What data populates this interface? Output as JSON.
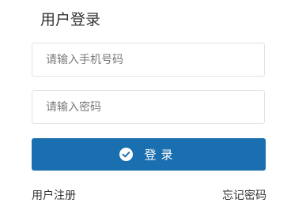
{
  "title": "用户登录",
  "phone": {
    "value": "",
    "placeholder": "请输入手机号码"
  },
  "password": {
    "value": "",
    "placeholder": "请输入密码"
  },
  "login_button": {
    "label": "登录",
    "icon": "check-circle-icon",
    "color": "#1a6fb0"
  },
  "links": {
    "register": "用户注册",
    "forgot": "忘记密码"
  }
}
